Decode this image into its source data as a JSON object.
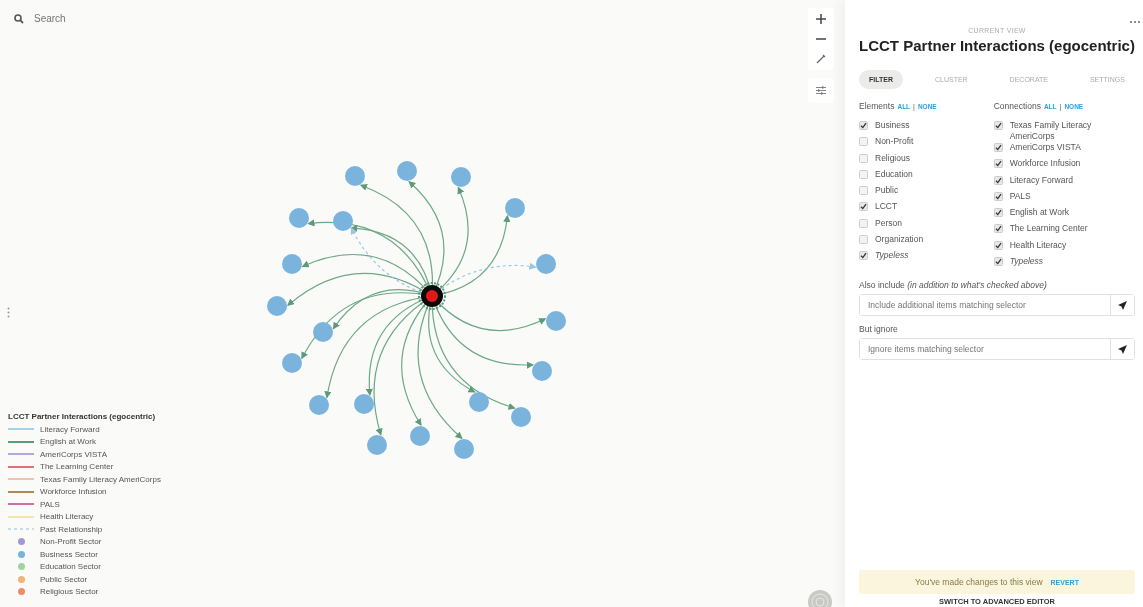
{
  "search": {
    "placeholder": "Search"
  },
  "legend": {
    "title": "LCCT Partner Interactions (egocentric)",
    "items": [
      {
        "kind": "line",
        "label": "Literacy Forward",
        "color": "#a6d2e8"
      },
      {
        "kind": "line",
        "label": "English at Work",
        "color": "#5b9a7a"
      },
      {
        "kind": "line",
        "label": "AmeriCorps VISTA",
        "color": "#b3a8d6"
      },
      {
        "kind": "line",
        "label": "The Learning Center",
        "color": "#e0707a"
      },
      {
        "kind": "line",
        "label": "Texas Family Literacy AmeriCorps",
        "color": "#f2c2b0"
      },
      {
        "kind": "line",
        "label": "Workforce Infusion",
        "color": "#b08a55"
      },
      {
        "kind": "line",
        "label": "PALS",
        "color": "#d070a0"
      },
      {
        "kind": "line",
        "label": "Health Literacy",
        "color": "#f5e4a8"
      },
      {
        "kind": "dashed",
        "label": "Past Relationship",
        "color": "#c8dbe8"
      },
      {
        "kind": "dot",
        "label": "Non-Profit Sector",
        "color": "#a29ad0"
      },
      {
        "kind": "dot",
        "label": "Business Sector",
        "color": "#7ab4dc"
      },
      {
        "kind": "dot",
        "label": "Education Sector",
        "color": "#9fd69a"
      },
      {
        "kind": "dot",
        "label": "Public Sector",
        "color": "#f2b27a"
      },
      {
        "kind": "dot",
        "label": "Religious Sector",
        "color": "#ef8a6a"
      }
    ]
  },
  "panel": {
    "eyebrow": "CURRENT VIEW",
    "title": "LCCT Partner Interactions (egocentric)",
    "tabs": [
      {
        "label": "FILTER",
        "selected": true
      },
      {
        "label": "CLUSTER",
        "selected": false
      },
      {
        "label": "DECORATE",
        "selected": false
      },
      {
        "label": "SETTINGS",
        "selected": false
      }
    ],
    "columns": [
      {
        "heading": "Elements",
        "all": "ALL",
        "separator": "|",
        "none": "NONE",
        "items": [
          {
            "label": "Business",
            "checked": true,
            "italic": false
          },
          {
            "label": "Non-Profit",
            "checked": false,
            "italic": false
          },
          {
            "label": "Religious",
            "checked": false,
            "italic": false
          },
          {
            "label": "Education",
            "checked": false,
            "italic": false
          },
          {
            "label": "Public",
            "checked": false,
            "italic": false
          },
          {
            "label": "LCCT",
            "checked": true,
            "italic": false
          },
          {
            "label": "Person",
            "checked": false,
            "italic": false
          },
          {
            "label": "Organization",
            "checked": false,
            "italic": false
          },
          {
            "label": "Typeless",
            "checked": true,
            "italic": true
          }
        ]
      },
      {
        "heading": "Connections",
        "all": "ALL",
        "separator": "|",
        "none": "NONE",
        "items": [
          {
            "label": "Texas Family Literacy AmeriCorps",
            "checked": true,
            "italic": false
          },
          {
            "label": "AmeriCorps VISTA",
            "checked": true,
            "italic": false
          },
          {
            "label": "Workforce Infusion",
            "checked": true,
            "italic": false
          },
          {
            "label": "Literacy Forward",
            "checked": true,
            "italic": false
          },
          {
            "label": "PALS",
            "checked": true,
            "italic": false
          },
          {
            "label": "English at Work",
            "checked": true,
            "italic": false
          },
          {
            "label": "The Learning Center",
            "checked": true,
            "italic": false
          },
          {
            "label": "Health Literacy",
            "checked": true,
            "italic": false
          },
          {
            "label": "Typeless",
            "checked": true,
            "italic": true
          }
        ]
      }
    ],
    "include": {
      "label": "Also include *(in addition to what's checked above)*",
      "placeholder": "Include additional items matching selector"
    },
    "ignore": {
      "label": "But ignore",
      "placeholder": "Ignore items matching selector"
    },
    "notice": {
      "text": "You've made changes to this view",
      "action": "REVERT"
    },
    "footer_link": "SWITCH TO ADVANCED EDITOR"
  }
}
